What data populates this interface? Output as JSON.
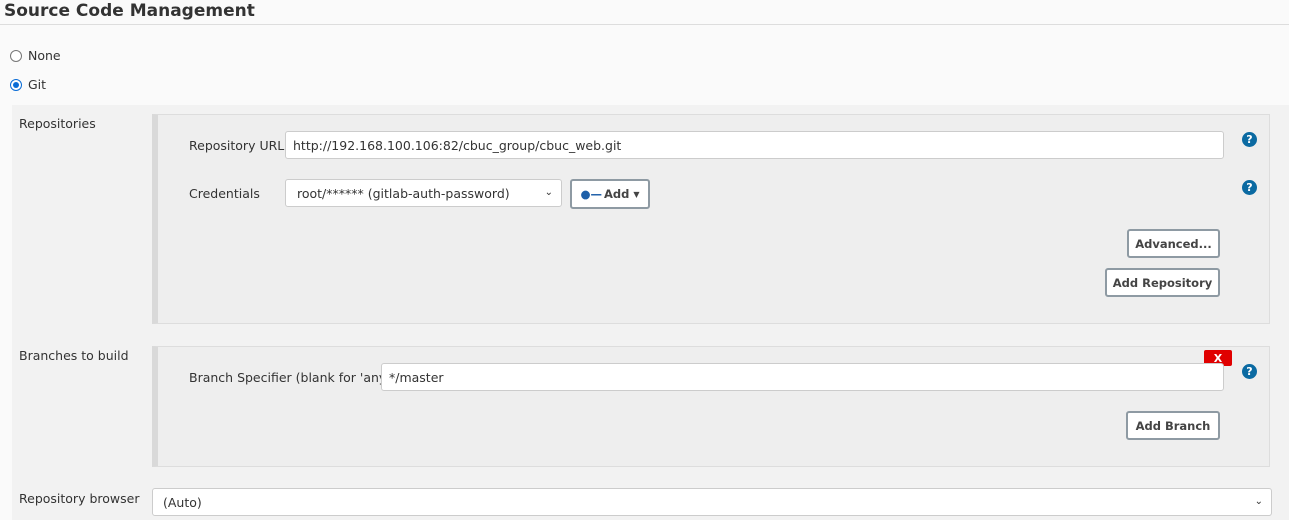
{
  "header": {
    "title": "Source Code Management"
  },
  "scm": {
    "options": [
      {
        "label": "None",
        "selected": false
      },
      {
        "label": "Git",
        "selected": true
      }
    ]
  },
  "repositories": {
    "label": "Repositories",
    "url_label": "Repository URL",
    "url_value": "http://192.168.100.106:82/cbuc_group/cbuc_web.git",
    "credentials_label": "Credentials",
    "credentials_value": "root/****** (gitlab-auth-password)",
    "add_label": "Add",
    "advanced_label": "Advanced...",
    "add_repository_label": "Add Repository"
  },
  "branches": {
    "label": "Branches to build",
    "specifier_label": "Branch Specifier (blank for 'any')",
    "specifier_value": "*/master",
    "delete_label": "X",
    "add_branch_label": "Add Branch"
  },
  "browser": {
    "label": "Repository browser",
    "value": "(Auto)"
  },
  "help_icon": "?",
  "colors": {
    "help": "#0b6aa2",
    "delete": "#e00000",
    "radio": "#0a6cd6"
  }
}
